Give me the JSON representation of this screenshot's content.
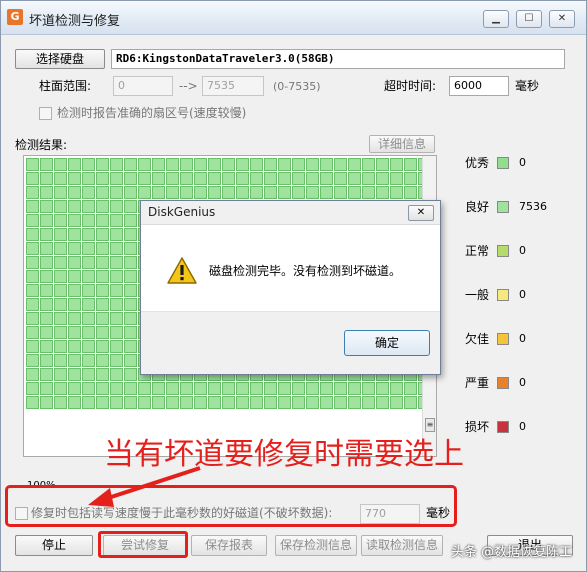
{
  "window": {
    "title": "坏道检测与修复",
    "app_icon_glyph": "G",
    "controls": {
      "minimize": "▁",
      "maximize": "☐",
      "close": "✕"
    }
  },
  "disk": {
    "select_button": "选择硬盘",
    "name": "RD6:KingstonDataTraveler3.0(58GB)"
  },
  "range": {
    "label": "柱面范围:",
    "start": "0",
    "arrow": "-->",
    "end": "7535",
    "hint": "(0-7535)"
  },
  "timeout": {
    "label": "超时时间:",
    "value": "6000",
    "unit": "毫秒"
  },
  "report_sector_label": "检测时报告准确的扇区号(速度较慢)",
  "results": {
    "label": "检测结果:",
    "details_button": "详细信息",
    "cell_count": 522
  },
  "legend": [
    {
      "label": "优秀",
      "color": "#8fdf8f",
      "count": "0"
    },
    {
      "label": "良好",
      "color": "#9fe39f",
      "count": "7536"
    },
    {
      "label": "正常",
      "color": "#b5dc6a",
      "count": "0"
    },
    {
      "label": "一般",
      "color": "#f7e77f",
      "count": "0"
    },
    {
      "label": "欠佳",
      "color": "#f5c43a",
      "count": "0"
    },
    {
      "label": "严重",
      "color": "#e8822a",
      "count": "0"
    },
    {
      "label": "损坏",
      "color": "#c8323c",
      "count": "0"
    }
  ],
  "progress": {
    "label": "100%",
    "value": 100
  },
  "repair_option": {
    "label": "修复时包括读写速度慢于此毫秒数的好磁道(不破坏数据):",
    "value": "770",
    "unit": "毫秒"
  },
  "buttons": {
    "stop": "停止",
    "try_repair": "尝试修复",
    "save_report": "保存报表",
    "save_info": "保存检测信息",
    "read_info": "读取检测信息",
    "exit": "退出"
  },
  "dialog": {
    "title": "DiskGenius",
    "close": "✕",
    "message": "磁盘检测完毕。没有检测到坏磁道。",
    "ok": "确定"
  },
  "annotation": {
    "text": "当有坏道要修复时需要选上",
    "color": "#e5201c"
  },
  "watermark": "头条 @数据恢复陈工"
}
